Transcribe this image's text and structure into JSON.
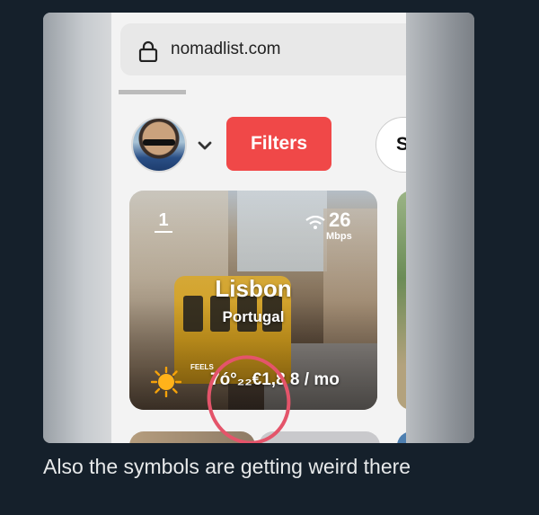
{
  "browser": {
    "url": "nomadlist.com",
    "lock_icon": "lock-icon"
  },
  "toolbar": {
    "avatar_icon": "avatar",
    "chevron_icon": "chevron-down-icon",
    "filters_label": "Filters",
    "sort_label": "S"
  },
  "city_card": {
    "rank": "1",
    "wifi_icon": "wifi-icon",
    "internet_speed": "26",
    "internet_unit": "Mbps",
    "city": "Lisbon",
    "country": "Portugal",
    "weather_icon": "sun-icon",
    "feels_label": "FEELS",
    "price_text": "7ó°₂₂€1,8 8 / mo"
  },
  "annotation": {
    "circle_color": "#e4546a"
  },
  "caption": {
    "text": "Also the symbols are getting weird there"
  },
  "colors": {
    "filters_button": "#f04848",
    "page_background": "#15202b",
    "caption_text": "#e7e9ea"
  }
}
